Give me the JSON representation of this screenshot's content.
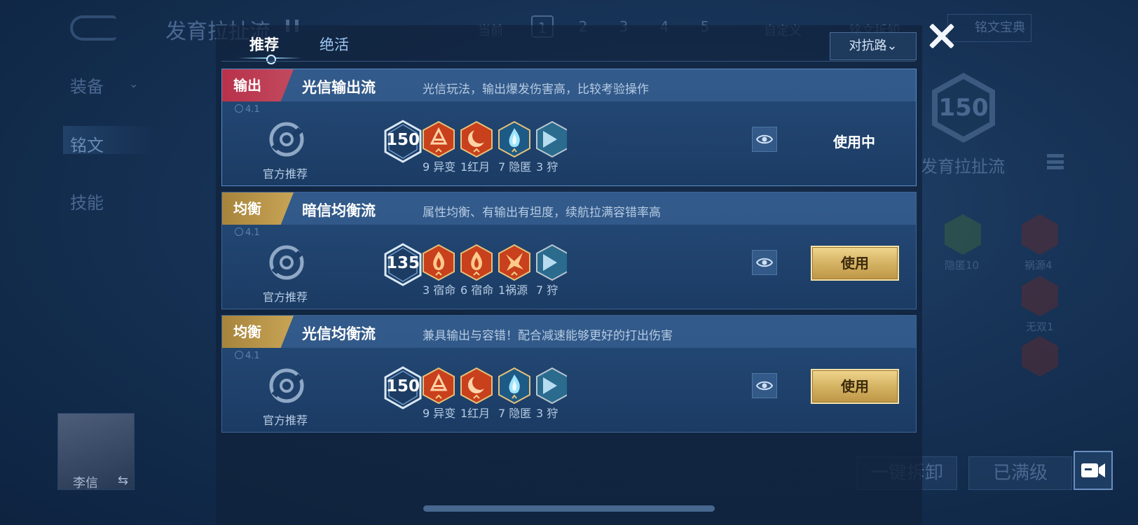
{
  "background": {
    "title": "发育拉扯流",
    "current_label": "当前",
    "pages": [
      "1",
      "2",
      "3",
      "4",
      "5"
    ],
    "custom_label": "自定义",
    "clear_label": "铭文拆卸",
    "dict_label": "铭文宝典",
    "side_tabs": [
      "装备",
      "铭文",
      "技能"
    ],
    "badge_level": "150",
    "badge_name": "发育拉扯流",
    "rune_labels": [
      "隐匿10",
      "祸源4",
      "无双1"
    ],
    "hero_name": "李信",
    "swap_glyph": "⇆",
    "one_click_remove": "一键拆卸",
    "maxed_label": "已满级"
  },
  "modal": {
    "tabs": [
      "推荐",
      "绝活"
    ],
    "active_tab": 0,
    "lane_dropdown": "对抗路⌄",
    "cards": [
      {
        "tag": "输出",
        "tag_color": "red",
        "name": "光信输出流",
        "description": "光信玩法，输出爆发伤害高，比较考验操作",
        "version": "4.1",
        "source_label": "官方推荐",
        "level": "150",
        "runes": [
          {
            "label": "9 异变",
            "kind": "red-rune-a"
          },
          {
            "label": "1红月",
            "kind": "red-rune-moon"
          },
          {
            "label": "7 隐匿",
            "kind": "blue-rune-flame"
          },
          {
            "label": "3 狩",
            "kind": "partial-rune"
          }
        ],
        "status": "in_use",
        "action_label": "使用中"
      },
      {
        "tag": "均衡",
        "tag_color": "gold",
        "name": "暗信均衡流",
        "description": "属性均衡、有输出有坦度，续航拉满容错率高",
        "version": "4.1",
        "source_label": "官方推荐",
        "level": "135",
        "runes": [
          {
            "label": "3 宿命",
            "kind": "red-rune-flame"
          },
          {
            "label": "6 宿命",
            "kind": "red-rune-flame"
          },
          {
            "label": "1祸源",
            "kind": "red-rune-burst"
          },
          {
            "label": "7 狩",
            "kind": "partial-rune"
          }
        ],
        "status": "available",
        "action_label": "使用"
      },
      {
        "tag": "均衡",
        "tag_color": "gold",
        "name": "光信均衡流",
        "description": "兼具输出与容错！配合减速能够更好的打出伤害",
        "version": "4.1",
        "source_label": "官方推荐",
        "level": "150",
        "runes": [
          {
            "label": "9 异变",
            "kind": "red-rune-a"
          },
          {
            "label": "1红月",
            "kind": "red-rune-moon"
          },
          {
            "label": "7 隐匿",
            "kind": "blue-rune-flame"
          },
          {
            "label": "3 狩",
            "kind": "partial-rune"
          }
        ],
        "status": "available",
        "action_label": "使用"
      }
    ]
  },
  "colors": {
    "tag_red": "#b8314a",
    "tag_gold": "#c8a456",
    "use_button": "#d7b667"
  }
}
